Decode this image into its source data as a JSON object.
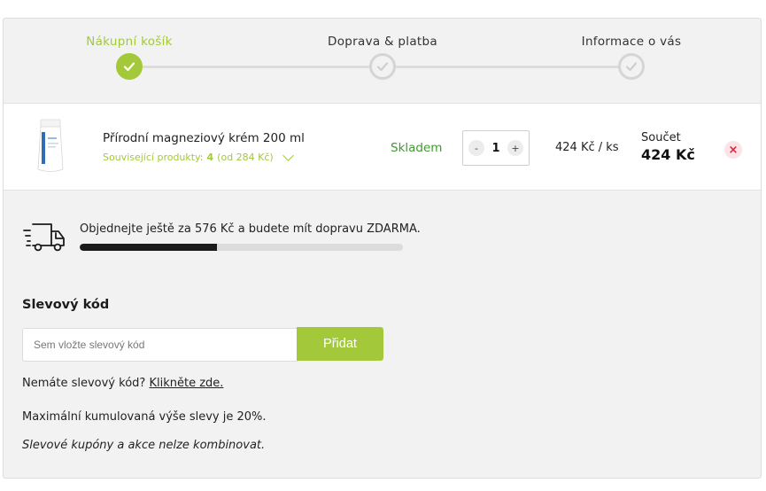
{
  "steps": [
    {
      "label": "Nákupní košík",
      "state": "active"
    },
    {
      "label": "Doprava & platba",
      "state": "inactive"
    },
    {
      "label": "Informace o vás",
      "state": "inactive"
    }
  ],
  "product": {
    "name": "Přírodní magneziový krém 200 ml",
    "related_prefix": "Související produkty:",
    "related_count": "4",
    "related_price": "(od 284 Kč)",
    "stock": "Skladem",
    "quantity": "1",
    "qty_minus": "-",
    "qty_plus": "+",
    "unit_price": "424 Kč / ks",
    "sum_label": "Součet",
    "sum_value": "424 Kč",
    "remove_glyph": "×"
  },
  "shipping": {
    "text": "Objednejte ještě za 576 Kč a budete mít dopravu ZDARMA.",
    "progress": 0.424
  },
  "discount": {
    "title": "Slevový kód",
    "placeholder": "Sem vložte slevový kód",
    "button": "Přidat",
    "no_code_text": "Nemáte slevový kód?",
    "no_code_link": "Klikněte zde.",
    "max_text": "Maximální kumulovaná výše slevy je 20%.",
    "combine_text": "Slevové kupóny a akce nelze kombinovat."
  },
  "colors": {
    "accent": "#a3c93a",
    "stock": "#3f9b2d",
    "remove": "#e0203a",
    "progress_fill": "#1b1b1b"
  },
  "icons": {
    "step_check": "check-icon",
    "related_toggle": "chevron-down-icon",
    "remove": "close-icon",
    "shipping": "truck-icon"
  }
}
